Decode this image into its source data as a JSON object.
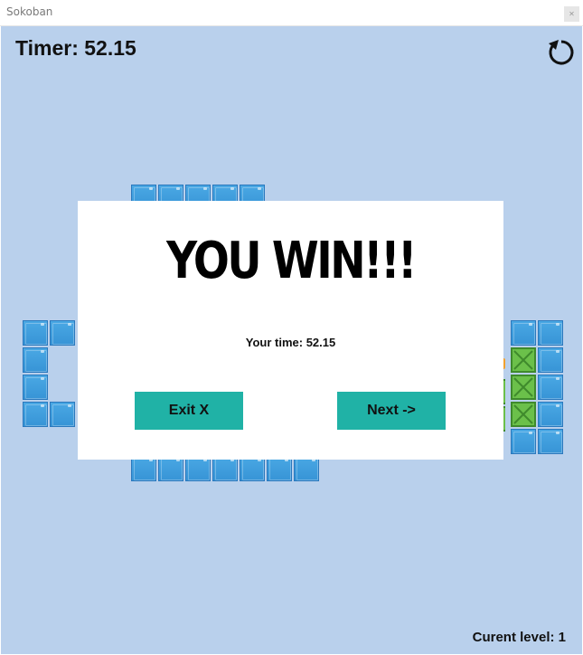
{
  "window": {
    "title": "Sokoban",
    "close_icon": "close-icon"
  },
  "hud": {
    "timer_text": "Timer: 52.15",
    "restart_icon": "restart-icon",
    "level_text": "Curent level: 1"
  },
  "modal": {
    "title": "YOU WIN!!!",
    "time_text": "Your time: 52.15",
    "exit_label": "Exit  X",
    "next_label": "Next ->"
  },
  "colors": {
    "background": "#b9d0ec",
    "wall_tile": "#3794d6",
    "crate_on_goal": "#6bc04a",
    "button": "#20b2a6"
  }
}
